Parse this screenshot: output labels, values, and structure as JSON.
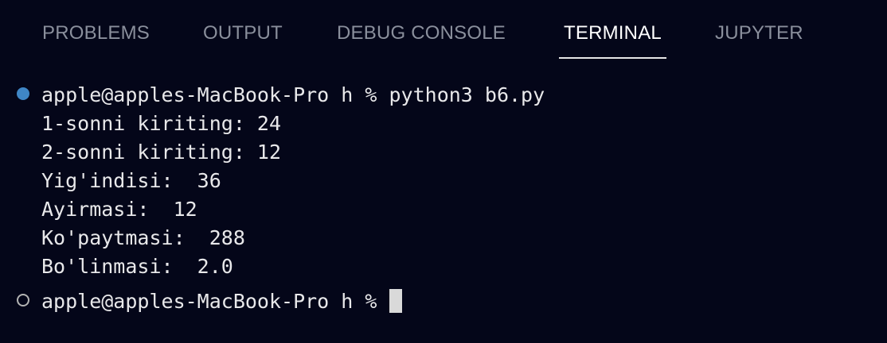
{
  "panel": {
    "tabs": [
      {
        "label": "PROBLEMS",
        "active": false
      },
      {
        "label": "OUTPUT",
        "active": false
      },
      {
        "label": "DEBUG CONSOLE",
        "active": false
      },
      {
        "label": "TERMINAL",
        "active": true
      },
      {
        "label": "JUPYTER",
        "active": false
      }
    ]
  },
  "terminal": {
    "prompt_1": "apple@apples-MacBook-Pro h % python3 b6.py",
    "output": [
      "1-sonni kiriting: 24",
      "2-sonni kiriting: 12",
      "Yig'indisi:  36",
      "Ayirmasi:  12",
      "Ko'paytmasi:  288",
      "Bo'linmasi:  2.0"
    ],
    "prompt_2": "apple@apples-MacBook-Pro h % ",
    "decorations": {
      "success_icon": "filled-circle-icon",
      "pending_icon": "hollow-circle-icon",
      "success_color": "#3f86c6",
      "cursor_color": "#d9d9d9"
    }
  }
}
